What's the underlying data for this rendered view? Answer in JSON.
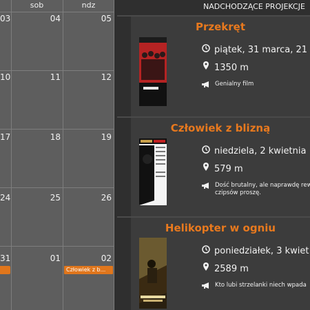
{
  "calendar": {
    "headers": [
      "",
      "sob",
      "ndz"
    ],
    "rows": [
      [
        "03",
        "04",
        "05"
      ],
      [
        "10",
        "11",
        "12"
      ],
      [
        "17",
        "18",
        "19"
      ],
      [
        "24",
        "25",
        "26"
      ],
      [
        "31",
        "01",
        "02"
      ]
    ],
    "event_label": "Człowiek z b..."
  },
  "panel": {
    "title": "NADCHODZĄCE PROJEKCJE",
    "movies": [
      {
        "title": "Przekręt",
        "date": "piątek, 31 marca, 21",
        "distance": "1350 m",
        "note": "Genialny film",
        "poster_colors": [
          "#b52323",
          "#1a1a1a"
        ]
      },
      {
        "title": "Człowiek z blizną",
        "date": "niedziela, 2 kwietnia",
        "distance": "579 m",
        "note": "Dość brutalny, ale naprawdę rew czipsów proszę.",
        "poster_colors": [
          "#111111",
          "#ffffff"
        ]
      },
      {
        "title": "Helikopter w ogniu",
        "date": "poniedziałek, 3 kwiet",
        "distance": "2589 m",
        "note": "Kto lubi strzelanki niech wpada",
        "poster_colors": [
          "#3a2a12",
          "#c8a55a"
        ]
      }
    ]
  },
  "colors": {
    "accent": "#e8791e",
    "calendar_bg": "#5e5e5e",
    "panel_bg": "#2f2f2f",
    "card_bg": "#3c3c3c"
  },
  "icons": {
    "date": "clock-icon",
    "distance": "map-pin-icon",
    "note": "megaphone-icon"
  }
}
